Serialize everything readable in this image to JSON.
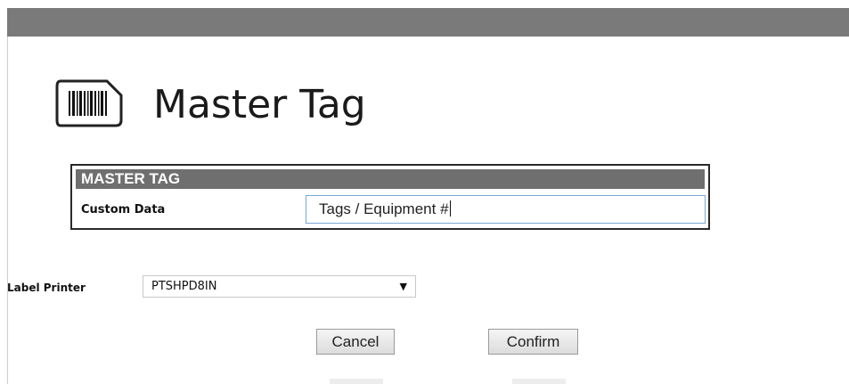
{
  "page": {
    "title": "Master Tag",
    "icon": "barcode-icon"
  },
  "panel": {
    "header": "MASTER TAG",
    "custom_data_label": "Custom Data",
    "custom_data_value": "Tags / Equipment #"
  },
  "printer": {
    "label": "Label Printer",
    "selected": "PTSHPD8IN",
    "arrow_icon": "triangle-down-icon"
  },
  "actions": {
    "cancel_label": "Cancel",
    "confirm_label": "Confirm"
  },
  "colors": {
    "topbar": "#7a7a7a",
    "panel_header": "#6f6f6f",
    "input_border": "#7aa7d6"
  }
}
